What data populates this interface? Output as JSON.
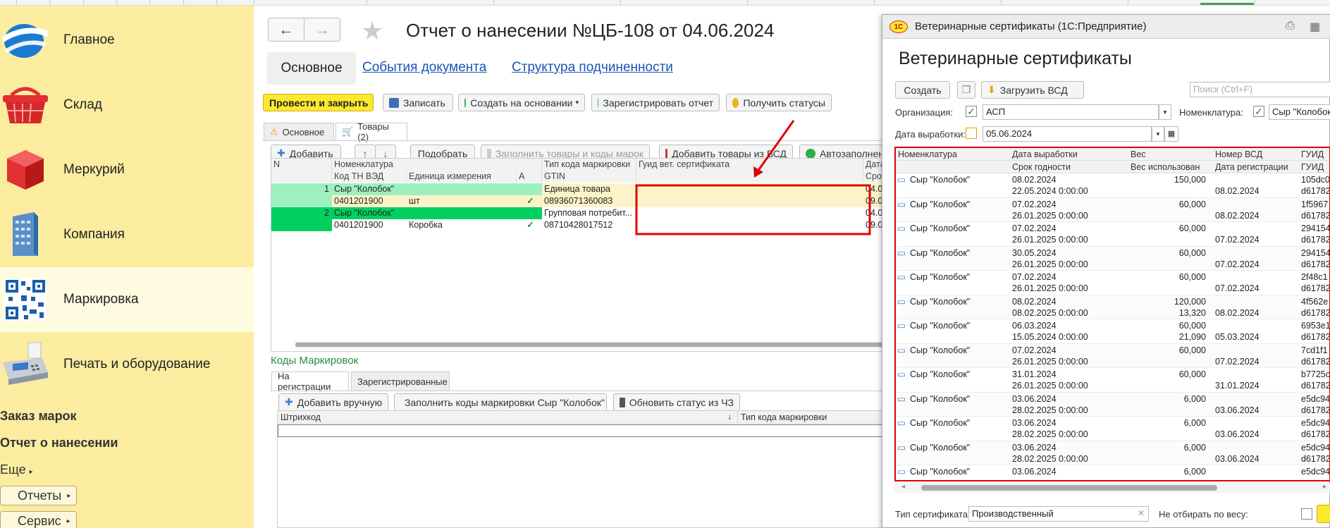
{
  "sidebar": {
    "items": [
      {
        "label": "Главное",
        "icon": "globe-icon"
      },
      {
        "label": "Склад",
        "icon": "basket-icon"
      },
      {
        "label": "Меркурий",
        "icon": "cube-icon"
      },
      {
        "label": "Компания",
        "icon": "building-icon"
      },
      {
        "label": "Маркировка",
        "icon": "qr-code-icon"
      },
      {
        "label": "Печать и оборудование",
        "icon": "cash-register-icon"
      }
    ],
    "commands": [
      "Заказ марок",
      "Отчет о нанесении"
    ],
    "more": "Еще",
    "buttons": [
      "Отчеты",
      "Сервис"
    ]
  },
  "doc": {
    "title": "Отчет о нанесении №ЦБ-108 от 04.06.2024",
    "tabs": [
      "Основное",
      "События документа",
      "Структура подчиненности"
    ],
    "toolbar": [
      "Провести и закрыть",
      "Записать",
      "Создать на основании",
      "Зарегистрировать отчет",
      "Получить статусы"
    ],
    "subtabs": [
      "Основное",
      "Товары (2)"
    ],
    "goods_toolbar": [
      "Добавить",
      "Подобрать",
      "Заполнить товары и коды марок",
      "Добавить товары из ВСД",
      "Автозаполнен"
    ],
    "goods_headers": {
      "n": "N",
      "nomenclature": "Номенклатура",
      "tnved": "Код ТН ВЭД",
      "unit": "Единица измерения",
      "a": "A",
      "code_type": "Тип кода маркировки",
      "gtin": "GTIN",
      "guid": "Гуид вет. сертификата",
      "date": "Дата",
      "exp": "Сро"
    },
    "goods_rows": [
      {
        "n": "1",
        "name": "Сыр \"Колобок\"",
        "tnved": "0401201900",
        "unit": "шт",
        "check": "✓",
        "code_type": "Единица товара",
        "gtin": "08936071360083",
        "guid": "",
        "date": "04.0",
        "exp": "09.0"
      },
      {
        "n": "2",
        "name": "Сыр \"Колобок\"",
        "tnved": "0401201900",
        "unit": "Коробка",
        "check": "✓",
        "code_type": "Групповая потребит...",
        "gtin": "08710428017512",
        "guid": "",
        "date": "04.0",
        "exp": "09.0"
      }
    ],
    "codes_title": "Коды Маркировок",
    "codes_tabs": [
      "На регистрации",
      "Зарегистрированные"
    ],
    "codes_toolbar": [
      "Добавить вручную",
      "Заполнить коды маркировки Сыр \"Колобок\"",
      "Обновить статус из ЧЗ"
    ],
    "codes_headers": [
      "Штрихкод",
      "↓",
      "Тип кода маркировки"
    ]
  },
  "vet": {
    "window_title": "Ветеринарные сертификаты  (1С:Предприятие)",
    "logo": "1C",
    "title": "Ветеринарные сертификаты",
    "create": "Создать",
    "load": "Загрузить ВСД",
    "search_placeholder": "Поиск (Ctrl+F)",
    "org_label": "Организация:",
    "org_value": "АСП",
    "nom_label": "Номенклатура:",
    "nom_value": "Сыр \"Колобок\"",
    "date_label": "Дата выработки:",
    "date_value": "05.06.2024",
    "headers": {
      "nom": "Номенклатура",
      "date": "Дата выработки",
      "exp": "Срок годности",
      "weight": "Вес",
      "used": "Вес использован",
      "vsd": "Номер ВСД",
      "reg": "Дата регистрации",
      "guid": "ГУИД",
      "guid2": "ГУИД"
    },
    "rows": [
      {
        "nom": "Сыр \"Колобок\"",
        "date": "08.02.2024",
        "exp": "22.05.2024 0:00:00",
        "weight": "150,000",
        "used": "",
        "reg": "08.02.2024",
        "g1": "105dc0",
        "g2": "d61782"
      },
      {
        "nom": "Сыр \"Колобок\"",
        "date": "07.02.2024",
        "exp": "26.01.2025 0:00:00",
        "weight": "60,000",
        "used": "",
        "reg": "08.02.2024",
        "g1": "1f5967",
        "g2": "d61782"
      },
      {
        "nom": "Сыр \"Колобок\"",
        "date": "07.02.2024",
        "exp": "26.01.2025 0:00:00",
        "weight": "60,000",
        "used": "",
        "reg": "07.02.2024",
        "g1": "294154",
        "g2": "d61782"
      },
      {
        "nom": "Сыр \"Колобок\"",
        "date": "30.05.2024",
        "exp": "26.01.2025 0:00:00",
        "weight": "60,000",
        "used": "",
        "reg": "07.02.2024",
        "g1": "294154",
        "g2": "d61782"
      },
      {
        "nom": "Сыр \"Колобок\"",
        "date": "07.02.2024",
        "exp": "26.01.2025 0:00:00",
        "weight": "60,000",
        "used": "",
        "reg": "07.02.2024",
        "g1": "2f48c1",
        "g2": "d61782"
      },
      {
        "nom": "Сыр \"Колобок\"",
        "date": "08.02.2024",
        "exp": "08.02.2025 0:00:00",
        "weight": "120,000",
        "used": "13,320",
        "reg": "08.02.2024",
        "g1": "4f562e",
        "g2": "d61782"
      },
      {
        "nom": "Сыр \"Колобок\"",
        "date": "06.03.2024",
        "exp": "15.05.2024 0:00:00",
        "weight": "60,000",
        "used": "21,090",
        "reg": "05.03.2024",
        "g1": "6953e1",
        "g2": "d61782"
      },
      {
        "nom": "Сыр \"Колобок\"",
        "date": "07.02.2024",
        "exp": "26.01.2025 0:00:00",
        "weight": "60,000",
        "used": "",
        "reg": "07.02.2024",
        "g1": "7cd1f1",
        "g2": "d61782"
      },
      {
        "nom": "Сыр \"Колобок\"",
        "date": "31.01.2024",
        "exp": "26.01.2025 0:00:00",
        "weight": "60,000",
        "used": "",
        "reg": "31.01.2024",
        "g1": "b7725c",
        "g2": "d61782"
      },
      {
        "nom": "Сыр \"Колобок\"",
        "date": "03.06.2024",
        "exp": "28.02.2025 0:00:00",
        "weight": "6,000",
        "used": "",
        "reg": "03.06.2024",
        "g1": "e5dc94",
        "g2": "d61782"
      },
      {
        "nom": "Сыр \"Колобок\"",
        "date": "03.06.2024",
        "exp": "28.02.2025 0:00:00",
        "weight": "6,000",
        "used": "",
        "reg": "03.06.2024",
        "g1": "e5dc94",
        "g2": "d61782"
      },
      {
        "nom": "Сыр \"Колобок\"",
        "date": "03.06.2024",
        "exp": "28.02.2025 0:00:00",
        "weight": "6,000",
        "used": "",
        "reg": "03.06.2024",
        "g1": "e5dc94",
        "g2": "d61782"
      },
      {
        "nom": "Сыр \"Колобок\"",
        "date": "03.06.2024",
        "exp": "",
        "weight": "6,000",
        "used": "",
        "reg": "",
        "g1": "e5dc94",
        "g2": ""
      }
    ],
    "cert_type_label": "Тип сертификата:",
    "cert_type_value": "Производственный",
    "no_weight_label": "Не отбирать по весу:"
  },
  "colors": {
    "sidebar_bg": "#fbeca0",
    "sidebar_active": "#fefbe1",
    "primary_button": "#fde830",
    "link": "#1a55b5",
    "highlight_red": "#e00000",
    "row_selected": "#00d060",
    "row_light": "#9ef0c0"
  }
}
